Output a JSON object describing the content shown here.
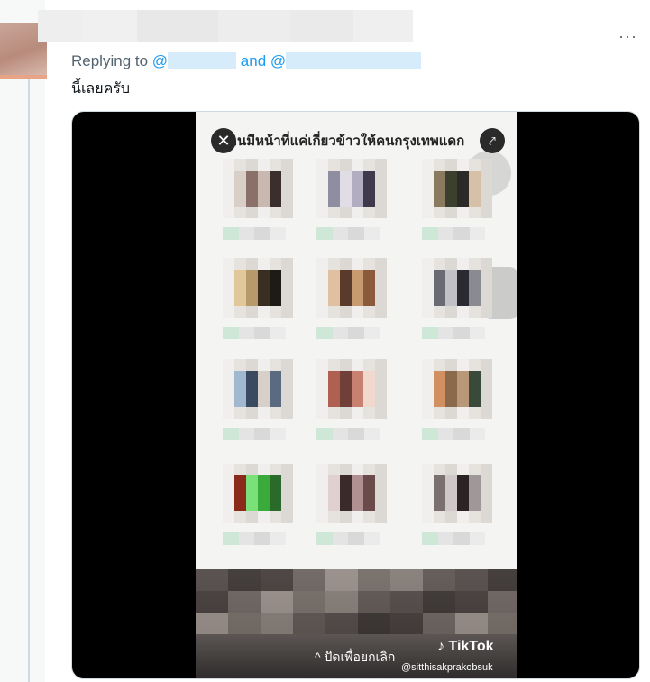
{
  "tweet": {
    "reply_prefix": "Replying to",
    "mention_symbol": "@",
    "and_word": "and",
    "text": "นี้เลยครับ",
    "more_label": "···"
  },
  "video": {
    "title": "คนมีหน้าที่แค่เกี่ยวข้าวให้คนกรุงเทพแดก",
    "close_label": "✕",
    "share_label": "⤤",
    "collapse_label": "^ ปัดเพื่อยกเลิก",
    "brand": "TikTok",
    "brand_icon": "♪",
    "handle": "@sitthisakprakobsuk"
  },
  "colors": {
    "mention": "#1d9bf0",
    "secondary_text": "#536471",
    "primary_text": "#0f1419"
  },
  "icons": [
    "more-icon",
    "close-icon",
    "share-icon",
    "tiktok-icon",
    "chevron-up-icon"
  ]
}
